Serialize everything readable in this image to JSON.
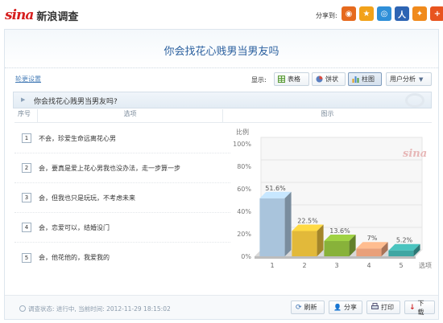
{
  "header": {
    "logo": "sina",
    "title": "新浪调查",
    "share_label": "分享到:",
    "share_icons": [
      {
        "name": "weibo-icon",
        "glyph": "◉",
        "color": "#e66a1e"
      },
      {
        "name": "favorite-star-icon",
        "glyph": "★",
        "color": "#f2a21a"
      },
      {
        "name": "qzone-icon",
        "glyph": "◎",
        "color": "#2f8fd8"
      },
      {
        "name": "renren-icon",
        "glyph": "人",
        "color": "#2d64b3"
      },
      {
        "name": "kaixin-icon",
        "glyph": "✦",
        "color": "#f08a1c"
      },
      {
        "name": "plus-icon",
        "glyph": "+",
        "color": "#e8541f"
      }
    ]
  },
  "page": {
    "title": "你会找花心贱男当男友吗",
    "settings_link": "轮更设置",
    "display_label": "显示:",
    "view_buttons": [
      {
        "label": "表格",
        "name": "table-view-button"
      },
      {
        "label": "饼状",
        "name": "pie-view-button"
      },
      {
        "label": "柱图",
        "name": "bar-view-button"
      },
      {
        "label": "用户分析",
        "name": "user-analysis-button"
      }
    ]
  },
  "question": {
    "text": "你会找花心贱男当男友吗?",
    "col_index": "序号",
    "col_option": "选项",
    "col_chart": "图示",
    "options": [
      {
        "num": "1",
        "text": "不会，珍爱生命远离花心男"
      },
      {
        "num": "2",
        "text": "会，要真是爱上花心男我也没办法，走一步算一步"
      },
      {
        "num": "3",
        "text": "会，但我也只是玩玩，不考虑未来"
      },
      {
        "num": "4",
        "text": "会，恋爱可以，结婚没门"
      },
      {
        "num": "5",
        "text": "会，他花他的，我爱我的"
      }
    ]
  },
  "chart_data": {
    "type": "bar",
    "categories": [
      "1",
      "2",
      "3",
      "4",
      "5"
    ],
    "values": [
      51.6,
      22.5,
      13.6,
      7,
      5.2
    ],
    "value_labels": [
      "51.6%",
      "22.5%",
      "13.6%",
      "7%",
      "5.2%"
    ],
    "ylim": [
      0,
      100
    ],
    "yticks": [
      "0%",
      "20%",
      "40%",
      "60%",
      "80%",
      "100%"
    ],
    "ylabel": "比例",
    "xlabel": "选项",
    "watermark": "sina",
    "colors": [
      "#a9c4dc",
      "#e2b93a",
      "#88b23a",
      "#e9a07a",
      "#3fa6a2"
    ]
  },
  "footer": {
    "status": "调查状态: 进行中, 当前时间: 2012-11-29 18:15:02",
    "buttons": [
      {
        "label": "刷新",
        "name": "refresh-button",
        "icon": "refresh-icon"
      },
      {
        "label": "分享",
        "name": "share-button",
        "icon": "share-user-icon"
      },
      {
        "label": "打印",
        "name": "print-button",
        "icon": "print-icon"
      },
      {
        "label": "下载",
        "name": "download-button",
        "icon": "download-icon"
      }
    ]
  }
}
